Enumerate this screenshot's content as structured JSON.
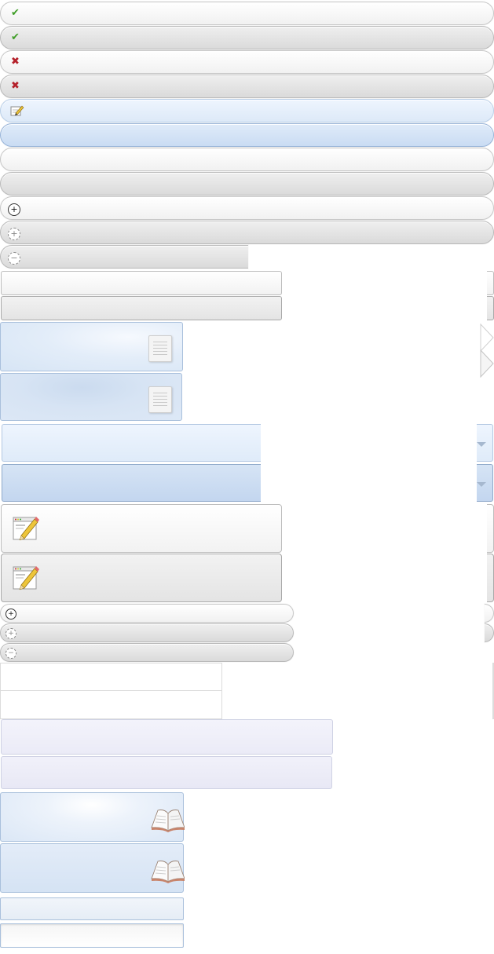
{
  "sprite": {
    "rows": {
      "ok": {
        "icon": "check-icon"
      },
      "error": {
        "icon": "cross-icon"
      },
      "edit": {
        "icon": "edit-icon"
      },
      "expand": {
        "icon": "plus-circle-icon"
      },
      "collapse": {
        "icon": "minus-circle-icon"
      }
    },
    "panels": {
      "doc": {
        "icon": "document-icon"
      },
      "pencil": {
        "icon": "pencil-note-icon"
      },
      "book": {
        "icon": "book-icon"
      },
      "dropdown": {
        "icon": "dropdown-arrow-icon"
      },
      "next": {
        "icon": "chevron-right-icon"
      }
    },
    "colors": {
      "check": "#3f9e27",
      "cross": "#b4202a",
      "blue_light": "#e6eff9",
      "blue_border": "#a9c0dc"
    }
  }
}
